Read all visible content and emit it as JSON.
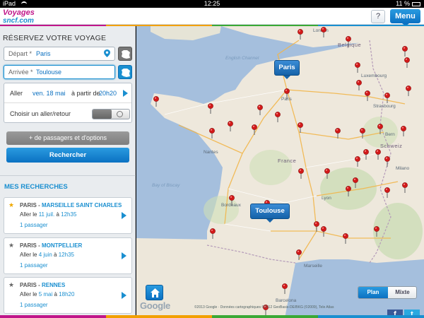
{
  "status_bar": {
    "device": "iPad",
    "time": "12:25",
    "battery": "11 %"
  },
  "header": {
    "logo_line1": "Voyages",
    "logo_line2": "sncf.com",
    "help_label": "?",
    "menu_label": "Menu"
  },
  "form": {
    "title": "RÉSERVEZ VOTRE VOYAGE",
    "depart_label": "Départ *",
    "depart_value": "Paris",
    "arrivee_label": "Arrivée *",
    "arrivee_value": "Toulouse",
    "aller_label": "Aller",
    "aller_date": "ven. 18 mai",
    "aller_from": "à partir de",
    "aller_time": "20h20",
    "aller_retour_label": "Choisir un aller/retour",
    "passengers_button": "+ de passagers et d'options",
    "search_button": "Rechercher"
  },
  "recent": {
    "title": "MES RECHERCHES",
    "items": [
      {
        "from": "PARIS",
        "dash": " - ",
        "to": "MARSEILLE SAINT CHARLES",
        "aller": "Aller le",
        "date": "11 juil.",
        "a": "à",
        "time": "12h35",
        "pax": "1 passager",
        "favorite": true
      },
      {
        "from": "PARIS",
        "dash": " - ",
        "to": "MONTPELLIER",
        "aller": "Aller le",
        "date": "4 juin",
        "a": "à",
        "time": "12h35",
        "pax": "1 passager",
        "favorite": false
      },
      {
        "from": "PARIS",
        "dash": " - ",
        "to": "RENNES",
        "aller": "Aller le",
        "date": "5 mai",
        "a": "à",
        "time": "18h20",
        "pax": "1 passager",
        "favorite": false
      }
    ]
  },
  "map": {
    "callout_paris": "Paris",
    "callout_toulouse": "Toulouse",
    "labels": {
      "english_channel": "English Channel",
      "london": "London",
      "bay_of_biscay": "Bay of Biscay",
      "france": "France",
      "paris": "Paris",
      "nantes": "Nantes",
      "bordeaux": "Bordeaux",
      "toulouse": "Toulouse",
      "marseille": "Marseille",
      "lyon": "Lyon",
      "strasbourg": "Strasbourg",
      "bern": "Bern",
      "schweiz": "Schweiz",
      "milano": "Milano",
      "barcelona": "Barcelona",
      "luxembourg": "Luxembourg",
      "belgique": "Belgique"
    },
    "google": "Google",
    "copyright": "©2013 Google · Données cartographiques ©2012 GeoBasis-DE/BKG (©2009), Tele Atlas",
    "mode_plan": "Plan",
    "mode_mixte": "Mixte"
  },
  "social": {
    "facebook": "f",
    "twitter": "t"
  }
}
